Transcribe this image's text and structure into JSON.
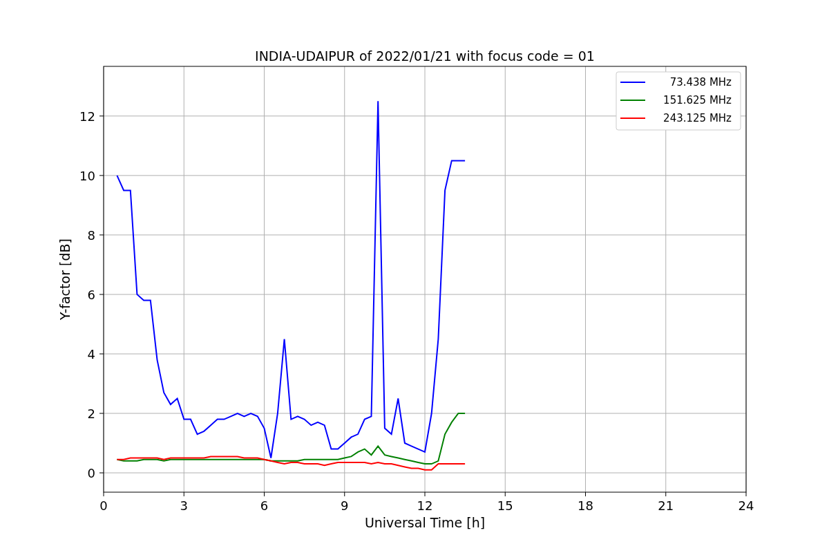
{
  "figure": {
    "chart_data": {
      "type": "line",
      "title": "INDIA-UDAIPUR of 2022/01/21 with focus code = 01",
      "xlabel": "Universal Time [h]",
      "ylabel": "Y-factor [dB]",
      "x": [
        0.5,
        0.75,
        1.0,
        1.25,
        1.5,
        1.75,
        2.0,
        2.25,
        2.5,
        2.75,
        3.0,
        3.25,
        3.5,
        3.75,
        4.0,
        4.25,
        4.5,
        4.75,
        5.0,
        5.25,
        5.5,
        5.75,
        6.0,
        6.25,
        6.5,
        6.75,
        7.0,
        7.25,
        7.5,
        7.75,
        8.0,
        8.25,
        8.5,
        8.75,
        9.0,
        9.25,
        9.5,
        9.75,
        10.0,
        10.25,
        10.5,
        10.75,
        11.0,
        11.25,
        11.5,
        11.75,
        12.0,
        12.25,
        12.5,
        12.75,
        13.0,
        13.25,
        13.5
      ],
      "series": [
        {
          "name": "73.438 MHz",
          "color": "#0000ff",
          "values": [
            10.0,
            9.5,
            9.5,
            6.0,
            5.8,
            5.8,
            3.8,
            2.7,
            2.3,
            2.5,
            1.8,
            1.8,
            1.3,
            1.4,
            1.6,
            1.8,
            1.8,
            1.9,
            2.0,
            1.9,
            2.0,
            1.9,
            1.5,
            0.5,
            2.0,
            4.5,
            1.8,
            1.9,
            1.8,
            1.6,
            1.7,
            1.6,
            0.8,
            0.8,
            1.0,
            1.2,
            1.3,
            1.8,
            1.9,
            12.5,
            1.5,
            1.3,
            2.5,
            1.0,
            0.9,
            0.8,
            0.7,
            2.0,
            4.5,
            9.5,
            10.5,
            10.5,
            10.5
          ]
        },
        {
          "name": "151.625 MHz",
          "color": "#008000",
          "values": [
            0.45,
            0.4,
            0.4,
            0.4,
            0.45,
            0.45,
            0.45,
            0.4,
            0.45,
            0.45,
            0.45,
            0.45,
            0.45,
            0.45,
            0.45,
            0.45,
            0.45,
            0.45,
            0.45,
            0.45,
            0.45,
            0.45,
            0.45,
            0.4,
            0.4,
            0.4,
            0.4,
            0.4,
            0.45,
            0.45,
            0.45,
            0.45,
            0.45,
            0.45,
            0.5,
            0.55,
            0.7,
            0.8,
            0.6,
            0.9,
            0.6,
            0.55,
            0.5,
            0.45,
            0.4,
            0.35,
            0.3,
            0.3,
            0.4,
            1.3,
            1.7,
            2.0,
            2.0
          ]
        },
        {
          "name": "243.125 MHz",
          "color": "#ff0000",
          "values": [
            0.45,
            0.45,
            0.5,
            0.5,
            0.5,
            0.5,
            0.5,
            0.45,
            0.5,
            0.5,
            0.5,
            0.5,
            0.5,
            0.5,
            0.55,
            0.55,
            0.55,
            0.55,
            0.55,
            0.5,
            0.5,
            0.5,
            0.45,
            0.4,
            0.35,
            0.3,
            0.35,
            0.35,
            0.3,
            0.3,
            0.3,
            0.25,
            0.3,
            0.35,
            0.35,
            0.35,
            0.35,
            0.35,
            0.3,
            0.35,
            0.3,
            0.3,
            0.25,
            0.2,
            0.15,
            0.15,
            0.1,
            0.1,
            0.3,
            0.3,
            0.3,
            0.3,
            0.3
          ]
        }
      ],
      "grid": true,
      "legend": "upper right",
      "xlim": [
        0,
        24
      ],
      "ylim": [
        -0.65,
        13.67
      ],
      "xticks": [
        0,
        3,
        6,
        9,
        12,
        15,
        18,
        21,
        24
      ],
      "yticks": [
        0,
        2,
        4,
        6,
        8,
        10,
        12
      ]
    }
  }
}
